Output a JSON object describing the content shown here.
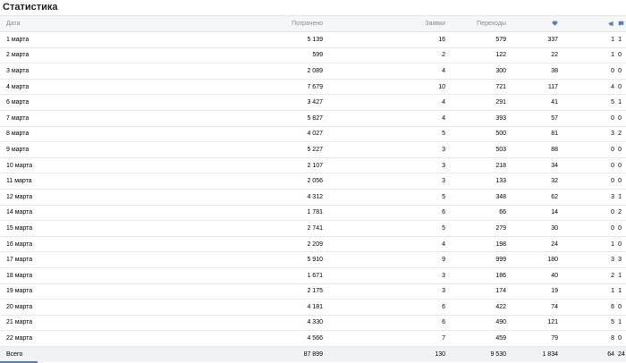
{
  "title": "Статистика",
  "headers": {
    "date": "Дата",
    "spent": "Потрачено",
    "applications": "Заявки",
    "transitions": "Переходы",
    "likes_icon": "heart-icon",
    "reposts_icon": "megaphone-icon",
    "comments_icon": "comment-icon"
  },
  "rows": [
    {
      "date": "1 марта",
      "spent": "5 139",
      "applications": "16",
      "transitions": "579",
      "likes": "337",
      "reposts": "1",
      "comments": "1"
    },
    {
      "date": "2 марта",
      "spent": "599",
      "applications": "2",
      "transitions": "122",
      "likes": "22",
      "reposts": "1",
      "comments": "0"
    },
    {
      "date": "3 марта",
      "spent": "2 089",
      "applications": "4",
      "transitions": "300",
      "likes": "38",
      "reposts": "0",
      "comments": "0"
    },
    {
      "date": "4 марта",
      "spent": "7 679",
      "applications": "10",
      "transitions": "721",
      "likes": "117",
      "reposts": "4",
      "comments": "0"
    },
    {
      "date": "6 марта",
      "spent": "3 427",
      "applications": "4",
      "transitions": "291",
      "likes": "41",
      "reposts": "5",
      "comments": "1"
    },
    {
      "date": "7 марта",
      "spent": "5 827",
      "applications": "4",
      "transitions": "393",
      "likes": "57",
      "reposts": "0",
      "comments": "0"
    },
    {
      "date": "8 марта",
      "spent": "4 027",
      "applications": "5",
      "transitions": "500",
      "likes": "81",
      "reposts": "3",
      "comments": "2"
    },
    {
      "date": "9 марта",
      "spent": "5 227",
      "applications": "3",
      "transitions": "503",
      "likes": "88",
      "reposts": "0",
      "comments": "0"
    },
    {
      "date": "10 марта",
      "spent": "2 107",
      "applications": "3",
      "transitions": "218",
      "likes": "34",
      "reposts": "0",
      "comments": "0"
    },
    {
      "date": "11 марта",
      "spent": "2 056",
      "applications": "3",
      "transitions": "133",
      "likes": "32",
      "reposts": "0",
      "comments": "0"
    },
    {
      "date": "12 марта",
      "spent": "4 312",
      "applications": "5",
      "transitions": "348",
      "likes": "62",
      "reposts": "3",
      "comments": "1"
    },
    {
      "date": "14 марта",
      "spent": "1 781",
      "applications": "6",
      "transitions": "66",
      "likes": "14",
      "reposts": "0",
      "comments": "2"
    },
    {
      "date": "15 марта",
      "spent": "2 741",
      "applications": "5",
      "transitions": "279",
      "likes": "30",
      "reposts": "0",
      "comments": "0"
    },
    {
      "date": "16 марта",
      "spent": "2 209",
      "applications": "4",
      "transitions": "198",
      "likes": "24",
      "reposts": "1",
      "comments": "0"
    },
    {
      "date": "17 марта",
      "spent": "5 910",
      "applications": "9",
      "transitions": "999",
      "likes": "180",
      "reposts": "3",
      "comments": "3"
    },
    {
      "date": "18 марта",
      "spent": "1 671",
      "applications": "3",
      "transitions": "186",
      "likes": "40",
      "reposts": "2",
      "comments": "1"
    },
    {
      "date": "19 марта",
      "spent": "2 175",
      "applications": "3",
      "transitions": "174",
      "likes": "19",
      "reposts": "1",
      "comments": "1"
    },
    {
      "date": "20 марта",
      "spent": "4 181",
      "applications": "6",
      "transitions": "422",
      "likes": "74",
      "reposts": "6",
      "comments": "0"
    },
    {
      "date": "21 марта",
      "spent": "4 330",
      "applications": "6",
      "transitions": "490",
      "likes": "121",
      "reposts": "5",
      "comments": "1"
    },
    {
      "date": "22 марта",
      "spent": "4 566",
      "applications": "7",
      "transitions": "459",
      "likes": "79",
      "reposts": "8",
      "comments": "0"
    }
  ],
  "totals": {
    "label": "Всего",
    "spent": "87 899",
    "applications": "130",
    "transitions": "9 530",
    "likes": "1 834",
    "reposts": "64",
    "comments": "24"
  },
  "colors": {
    "icon": "#5181b8",
    "header_text": "#818c99",
    "header_bg": "#f5f6f8"
  }
}
